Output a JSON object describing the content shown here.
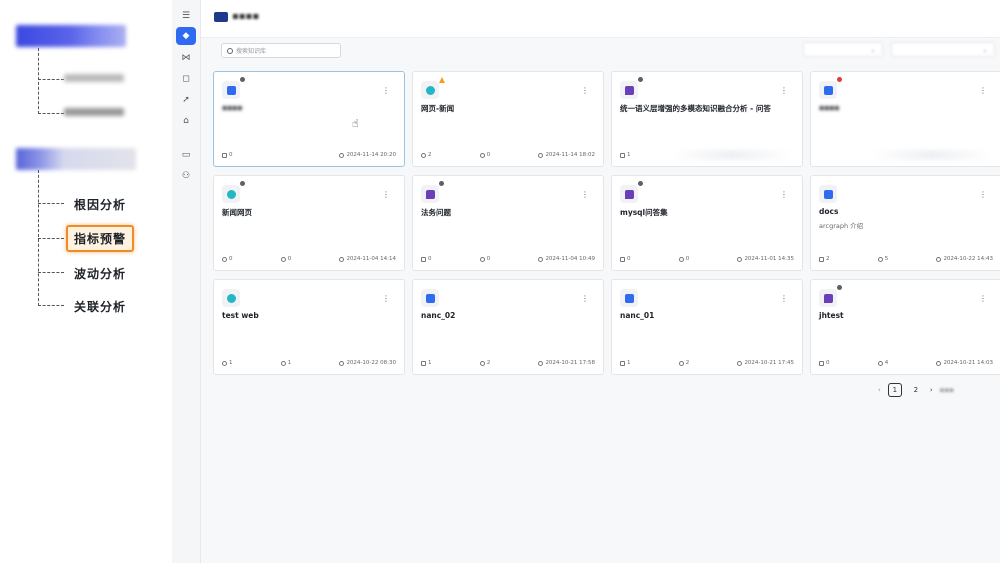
{
  "tree": {
    "items": [
      {
        "label": "根因分析"
      },
      {
        "label": "指标预警"
      },
      {
        "label": "波动分析"
      },
      {
        "label": "关联分析"
      }
    ]
  },
  "rail": {
    "icons": [
      "list-icon",
      "knowledge-icon",
      "graph-icon",
      "chat-icon",
      "rocket-icon",
      "database-icon",
      "message-icon",
      "user-settings-icon"
    ]
  },
  "search": {
    "placeholder": "搜索知识库"
  },
  "cards": [
    {
      "type": "doc",
      "title": "",
      "subtitle": "",
      "count1": "0",
      "count2": "",
      "date": "2024-11-14 20:20",
      "status": "gray"
    },
    {
      "type": "web",
      "title": "网页-新闻",
      "subtitle": "",
      "count1": "2",
      "count2": "0",
      "date": "2024-11-14 18:02",
      "status": "warn"
    },
    {
      "type": "chat",
      "title": "统一语义层增强的多模态知识融合分析 - 问答",
      "subtitle": "",
      "count1": "1",
      "count2": "",
      "date": "",
      "status": "gray"
    },
    {
      "type": "doc",
      "title": "",
      "subtitle": "",
      "count1": "",
      "count2": "",
      "date": "",
      "status": "red"
    },
    {
      "type": "web",
      "title": "新闻网页",
      "subtitle": "",
      "count1": "0",
      "count2": "0",
      "date": "2024-11-04 14:14",
      "status": "gray"
    },
    {
      "type": "chat",
      "title": "法务问题",
      "subtitle": "",
      "count1": "0",
      "count2": "0",
      "date": "2024-11-04 10:49",
      "status": "gray"
    },
    {
      "type": "chat",
      "title": "mysql问答集",
      "subtitle": "",
      "count1": "0",
      "count2": "0",
      "date": "2024-11-01 14:35",
      "status": "gray"
    },
    {
      "type": "doc",
      "title": "docs",
      "subtitle": "arcgraph 介绍",
      "count1": "2",
      "count2": "5",
      "date": "2024-10-22 14:43",
      "status": "none"
    },
    {
      "type": "web",
      "title": "test web",
      "subtitle": "",
      "count1": "1",
      "count2": "1",
      "date": "2024-10-22 08:30",
      "status": "none"
    },
    {
      "type": "doc",
      "title": "nanc_02",
      "subtitle": "",
      "count1": "1",
      "count2": "2",
      "date": "2024-10-21 17:58",
      "status": "none"
    },
    {
      "type": "doc",
      "title": "nanc_01",
      "subtitle": "",
      "count1": "1",
      "count2": "2",
      "date": "2024-10-21 17:45",
      "status": "none"
    },
    {
      "type": "chat",
      "title": "jhtest",
      "subtitle": "",
      "count1": "0",
      "count2": "4",
      "date": "2024-10-21 14:03",
      "status": "gray"
    }
  ],
  "pagination": {
    "prev": "‹",
    "pages": [
      "1",
      "2"
    ],
    "current": "1",
    "next": "›"
  }
}
